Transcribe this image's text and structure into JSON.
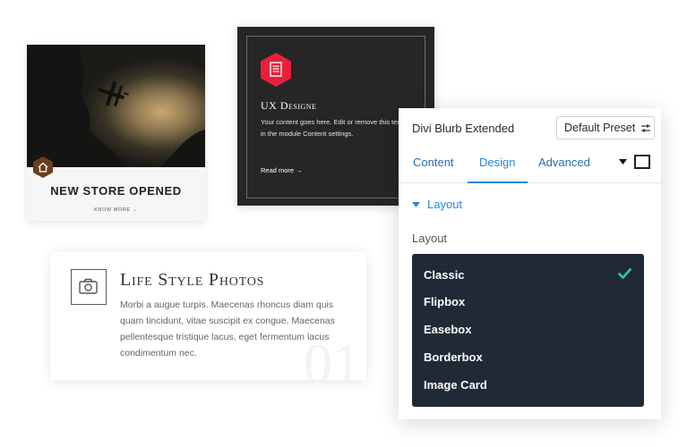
{
  "card_store": {
    "title": "NEW STORE OPENED",
    "link": "KNOW MORE →",
    "icon": "home-icon",
    "icon_color": "#6b3f1d"
  },
  "card_ux": {
    "title": "UX Designe",
    "description": "Your content goes here. Edit or remove this text inline or in the module Content settings.",
    "link": "Read more →",
    "icon": "document-icon",
    "icon_color": "#e8203c"
  },
  "card_life": {
    "title": "Life Style Photos",
    "description": "Morbi a augue turpis. Maecenas rhoncus diam quis quam tincidunt, vitae suscipit ex congue. Maecenas pellentesque tristique lacus, eget fermentum lacus condimentum nec.",
    "number": "01",
    "icon": "camera-icon"
  },
  "panel": {
    "title": "Divi Blurb Extended",
    "preset_label": "Default Preset",
    "tabs": [
      {
        "label": "Content",
        "active": false
      },
      {
        "label": "Design",
        "active": true
      },
      {
        "label": "Advanced",
        "active": false
      }
    ],
    "section_label": "Layout",
    "field_label": "Layout",
    "options": [
      {
        "label": "Classic",
        "selected": true
      },
      {
        "label": "Flipbox",
        "selected": false
      },
      {
        "label": "Easebox",
        "selected": false
      },
      {
        "label": "Borderbox",
        "selected": false
      },
      {
        "label": "Image Card",
        "selected": false
      }
    ],
    "accent_color": "#2b87da",
    "check_color": "#29c4a9"
  }
}
